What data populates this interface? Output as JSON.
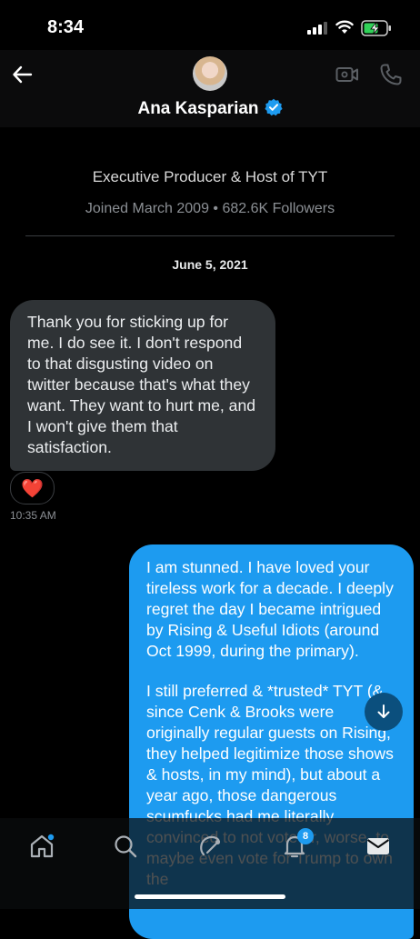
{
  "status_bar": {
    "time": "8:34"
  },
  "header": {
    "name": "Ana Kasparian",
    "back_icon": "arrow-left-icon",
    "verified_icon": "verified-badge-icon",
    "video_icon": "video-call-icon",
    "phone_icon": "phone-icon",
    "accent": "#1d9bf0"
  },
  "profile": {
    "bio": "Executive Producer & Host of TYT",
    "meta": "Joined March 2009 • 682.6K Followers"
  },
  "conversation": {
    "date": "June 5, 2021",
    "incoming": {
      "text": "Thank you for sticking up for me. I do see it. I don't respond to that disgusting video on twitter because that's what they want. They want to hurt me, and I won't give them that satisfaction.",
      "reaction": "❤️",
      "time": "10:35 AM"
    },
    "outgoing": {
      "para1": "I am stunned. I have loved your tireless work for a decade. I deeply regret the day I became intrigued by Rising & Useful Idiots (around Oct 1999, during the primary).",
      "para2": "I still preferred & *trusted* TYT (& since Cenk & Brooks were originally regular guests on Rising, they helped legitimize those shows & hosts, in my mind), but about a year ago, those dangerous scumfucks had me literally convinced to not vote or, worse, to maybe even vote for Trump to own the"
    }
  },
  "tabbar": {
    "items": [
      "home-icon",
      "search-icon",
      "spaces-icon",
      "notifications-icon",
      "messages-icon"
    ],
    "notification_badge": "8"
  }
}
